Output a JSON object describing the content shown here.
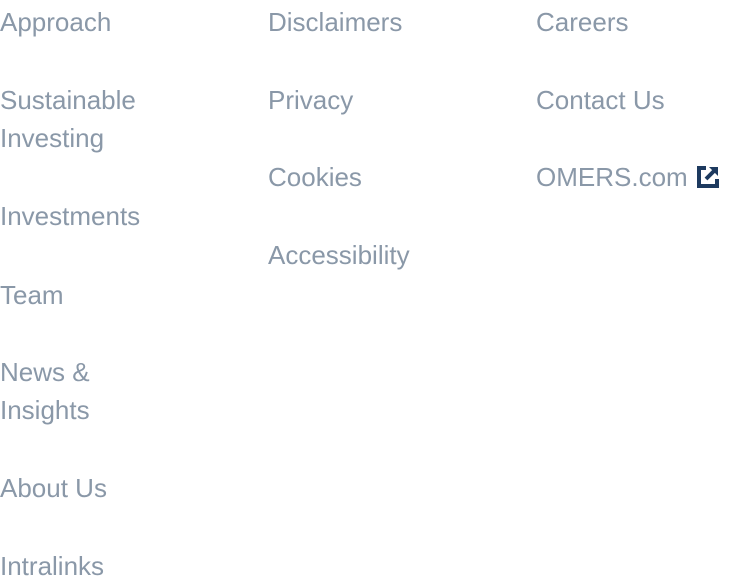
{
  "footer": {
    "column1": [
      {
        "label": "Approach"
      },
      {
        "label": "Sustainable Investing"
      },
      {
        "label": "Investments"
      },
      {
        "label": "Team"
      },
      {
        "label": "News & Insights"
      },
      {
        "label": "About Us"
      },
      {
        "label": "Intralinks"
      }
    ],
    "column2": [
      {
        "label": "Disclaimers"
      },
      {
        "label": "Privacy"
      },
      {
        "label": "Cookies"
      },
      {
        "label": "Accessibility"
      }
    ],
    "column3": [
      {
        "label": "Careers"
      },
      {
        "label": "Contact Us"
      },
      {
        "label": "OMERS.com",
        "icon": "external-link-icon"
      }
    ]
  },
  "colors": {
    "link_text": "#8a98a8",
    "external_icon": "#1d3a5f"
  }
}
